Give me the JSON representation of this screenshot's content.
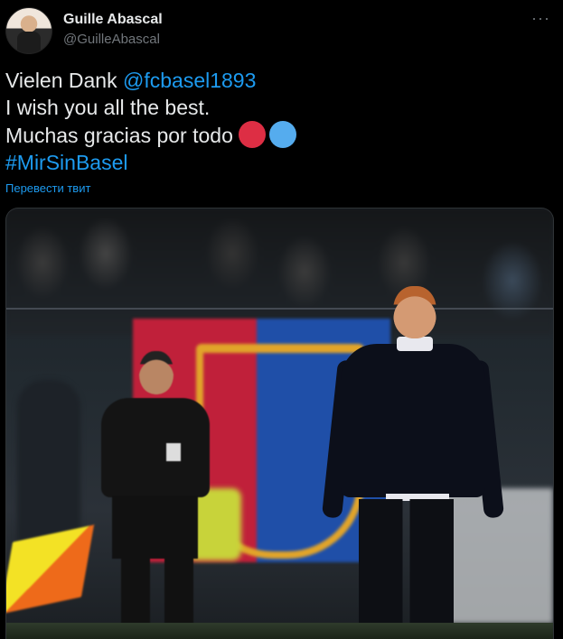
{
  "author": {
    "display_name": "Guille Abascal",
    "handle": "@GuilleAbascal"
  },
  "more_menu": "···",
  "tweet": {
    "line1_text": "Vielen Dank ",
    "line1_mention": "@fcbasel1893",
    "line2": "I wish you all the best.",
    "line3_text": "Muchas gracias por todo",
    "line4_hashtag": "#MirSinBasel",
    "emoji_colors": [
      "#dd2e44",
      "#55acee"
    ]
  },
  "translate_link": "Перевести твит",
  "colors": {
    "background": "#000000",
    "link": "#1d9bf0",
    "secondary_text": "#71767b"
  }
}
